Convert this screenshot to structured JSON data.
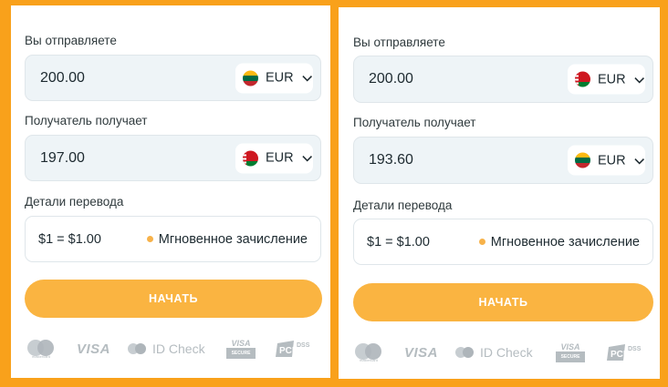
{
  "panels": [
    {
      "send_label": "Вы отправляете",
      "send_amount": "200.00",
      "send_currency": "EUR",
      "send_flag": "lithuania-flag-icon",
      "receive_label": "Получатель получает",
      "receive_amount": "197.00",
      "receive_currency": "EUR",
      "receive_flag": "belarus-flag-icon",
      "details_label": "Детали перевода",
      "rate": "$1 = $1.00",
      "instant": "Мгновенное зачисление",
      "start_button": "НАЧАТЬ"
    },
    {
      "send_label": "Вы отправляете",
      "send_amount": "200.00",
      "send_currency": "EUR",
      "send_flag": "belarus-flag-icon",
      "receive_label": "Получатель получает",
      "receive_amount": "193.60",
      "receive_currency": "EUR",
      "receive_flag": "lithuania-flag-icon",
      "details_label": "Детали перевода",
      "rate": "$1 = $1.00",
      "instant": "Мгновенное зачисление",
      "start_button": "НАЧАТЬ"
    }
  ],
  "payment_logos": {
    "mastercard_caption": "mastercard",
    "visa": "VISA",
    "id_check": "ID Check",
    "visa_secure_top": "VISA",
    "visa_secure_bottom": "SECURE",
    "pci_dss": "DSS"
  },
  "colors": {
    "background": "#f9a11b",
    "button": "#fab441",
    "field": "#eef4f7",
    "dot": "#f7b24a"
  }
}
